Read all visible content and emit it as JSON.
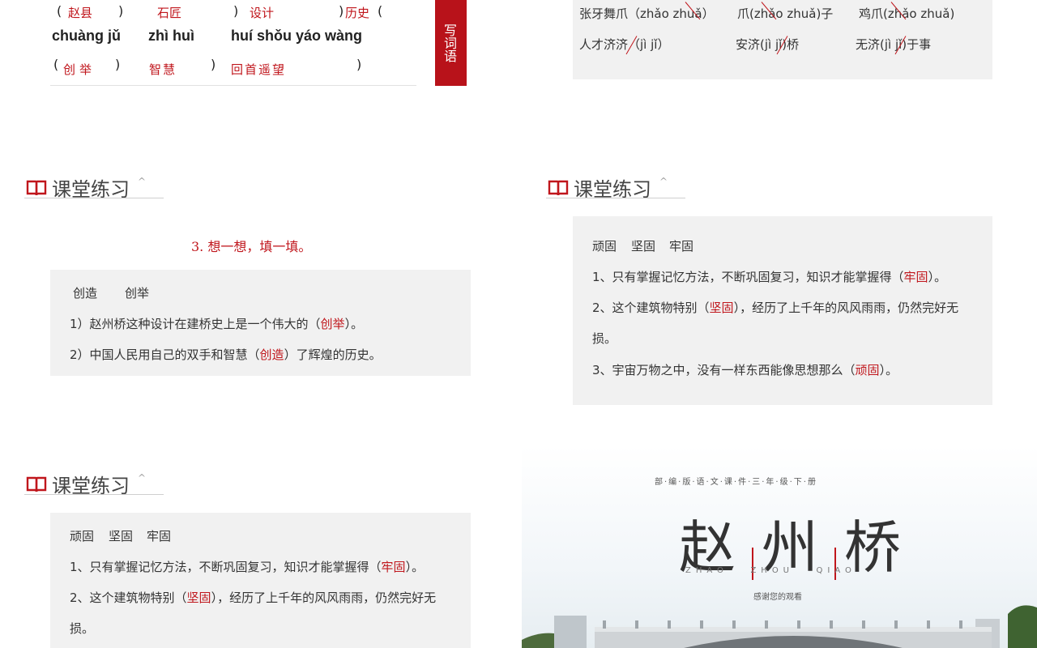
{
  "topleft": {
    "row1": [
      {
        "paren_open": "(",
        "answer": "赵县",
        "paren_close": ")"
      },
      {
        "answer": "石匠"
      },
      {
        "paren_close2": ")",
        "answer": "设计"
      },
      {
        "paren_close": ")",
        "after": "历史",
        "paren_open2": "("
      }
    ],
    "pinyin": [
      "chuàng jǔ",
      "zhì huì",
      "huí shǒu yáo wàng"
    ],
    "row3": [
      {
        "paren_open": "(",
        "answer": "创举",
        "paren_close": ")"
      },
      {
        "answer": "智慧",
        "paren_close": ")"
      },
      {
        "answer": "回首遥望",
        "paren_close": ")"
      }
    ],
    "banner": "写词语"
  },
  "topright": {
    "row1": [
      "张牙舞爪（zhǎo zhuǎ）",
      "爪(zhǎo zhuǎ)子",
      "鸡爪(zhǎo zhuǎ)"
    ],
    "row2": [
      "人才济济（jì jǐ）",
      "安济(jì jǐ)桥",
      "无济(jì jǐ)于事"
    ]
  },
  "section_title": "课堂练习",
  "mid_left": {
    "heading": "3. 想一想，填一填。",
    "words": [
      "创造",
      "创举"
    ],
    "lines": [
      {
        "pre": "1）赵州桥这种设计在建桥史上是一个伟大的（",
        "ans": "创举",
        "post": "）。"
      },
      {
        "pre": "2）中国人民用自己的双手和智慧（",
        "ans": "创造",
        "post": "）了辉煌的历史。"
      }
    ]
  },
  "mid_right": {
    "words": [
      "顽固",
      "坚固",
      "牢固"
    ],
    "lines": [
      {
        "pre": "1、只有掌握记忆方法，不断巩固复习，知识才能掌握得（",
        "ans": "牢固",
        "post": "）。"
      },
      {
        "pre": "2、这个建筑物特别（",
        "ans": "坚固",
        "post": "），经历了上千年的风风雨雨，仍然完好无"
      },
      {
        "pre": "损。",
        "ans": "",
        "post": ""
      },
      {
        "pre": "3、宇宙万物之中，没有一样东西能像思想那么（",
        "ans": "顽固",
        "post": "）。"
      }
    ]
  },
  "bottom_left": {
    "words": [
      "顽固",
      "坚固",
      "牢固"
    ],
    "lines": [
      {
        "pre": "1、只有掌握记忆方法，不断巩固复习，知识才能掌握得（",
        "ans": "牢固",
        "post": "）。"
      },
      {
        "pre": "2、这个建筑物特别（",
        "ans": "坚固",
        "post": "），经历了上千年的风风雨雨，仍然完好无"
      },
      {
        "pre": "损。",
        "ans": "",
        "post": ""
      }
    ]
  },
  "cover": {
    "subtitle": "部·编·版·语·文·课·件·三·年·级·下·册",
    "title_chars": [
      "赵",
      "州",
      "桥"
    ],
    "pinyin": "ZHAO   ZHOU   QIAO",
    "thanks": "感谢您的观看"
  },
  "colors": {
    "accent": "#c0161c",
    "panel": "#f1f1f1"
  }
}
